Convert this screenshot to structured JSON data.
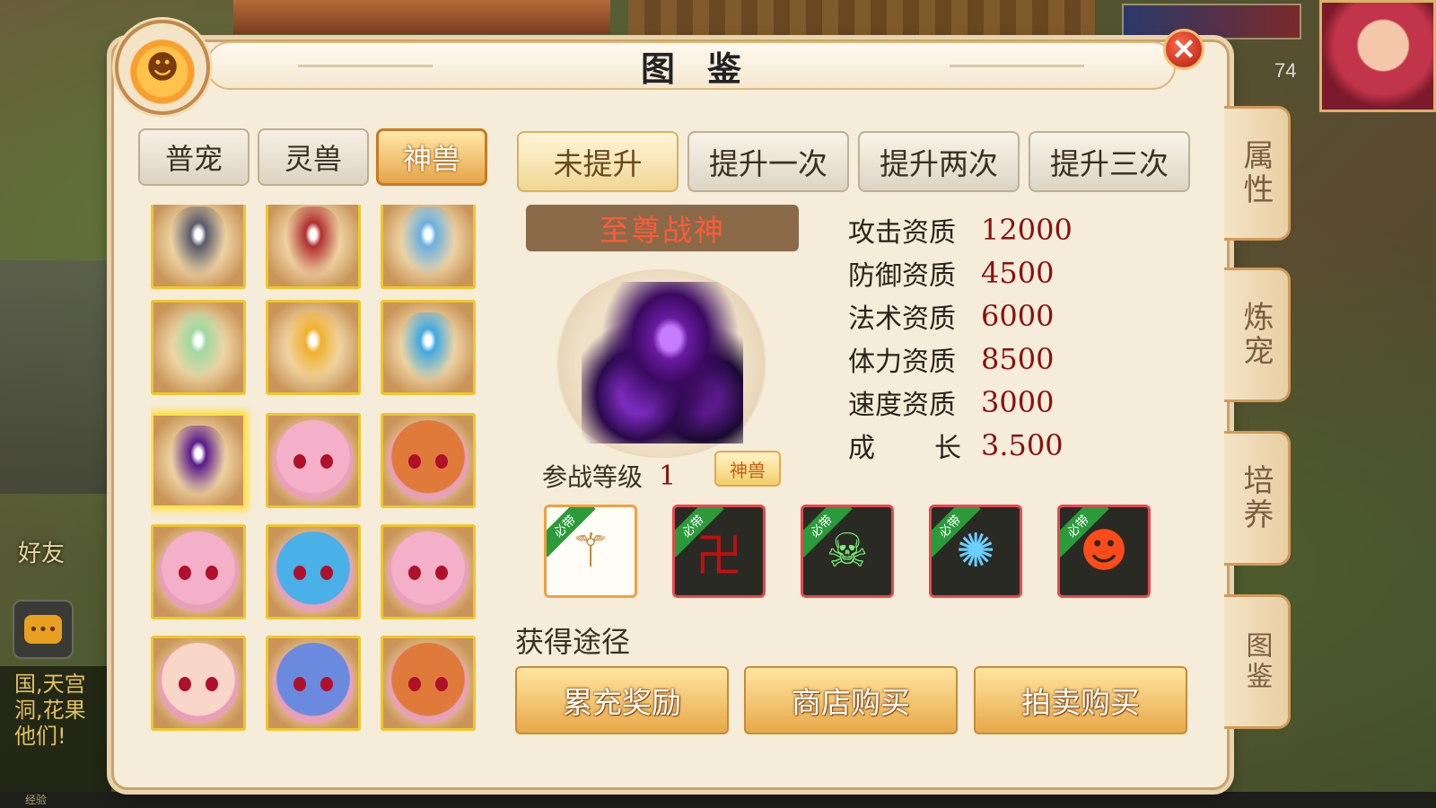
{
  "window": {
    "title": "图鉴"
  },
  "background": {
    "level_badge": "74",
    "friends_label": "好友",
    "chat_log": [
      "国,天宫",
      "洞,花果",
      "他们!"
    ],
    "exp_label": "经验"
  },
  "category_tabs": [
    {
      "label": "普宠",
      "active": false
    },
    {
      "label": "灵兽",
      "active": false
    },
    {
      "label": "神兽",
      "active": true
    }
  ],
  "upgrade_tabs": [
    {
      "label": "未提升",
      "active": true
    },
    {
      "label": "提升一次",
      "active": false
    },
    {
      "label": "提升两次",
      "active": false
    },
    {
      "label": "提升三次",
      "active": false
    }
  ],
  "pets": [
    {
      "name": "pet-1",
      "color": "#5a5a6a"
    },
    {
      "name": "pet-2",
      "color": "#b03030"
    },
    {
      "name": "pet-3",
      "color": "#6ab0e0"
    },
    {
      "name": "pet-4",
      "color": "#a0d8a0"
    },
    {
      "name": "pet-5",
      "color": "#f0b030"
    },
    {
      "name": "pet-6",
      "color": "#40a8e0"
    },
    {
      "name": "pet-7",
      "color": "#5a1a8a",
      "selected": true
    },
    {
      "name": "pet-8",
      "color": "#f4b0c8"
    },
    {
      "name": "pet-9",
      "color": "#e07a3a"
    },
    {
      "name": "pet-10",
      "color": "#f4b0c8"
    },
    {
      "name": "pet-11",
      "color": "#4ab0e8"
    },
    {
      "name": "pet-12",
      "color": "#f4b0c8"
    },
    {
      "name": "pet-13",
      "color": "#f8d6c8"
    },
    {
      "name": "pet-14",
      "color": "#6a8ae0"
    },
    {
      "name": "pet-15",
      "color": "#e07a3a"
    }
  ],
  "selected_pet": {
    "name": "至尊战神",
    "battle_level_label": "参战等级",
    "battle_level": "1",
    "badge": "神兽",
    "stats": [
      {
        "label": "攻击资质",
        "value": "12000"
      },
      {
        "label": "防御资质",
        "value": "4500"
      },
      {
        "label": "法术资质",
        "value": "6000"
      },
      {
        "label": "体力资质",
        "value": "8500"
      },
      {
        "label": "速度资质",
        "value": "3000"
      },
      {
        "label": "成长",
        "label_chars": [
          "成",
          "长"
        ],
        "value": "3.500"
      }
    ]
  },
  "skills": [
    {
      "ribbon": "必带",
      "icon": "staff-icon",
      "glyph": "⚚",
      "color": "#c07a20"
    },
    {
      "ribbon": "必带",
      "icon": "rune-icon",
      "glyph": "卍",
      "color": "#c01010"
    },
    {
      "ribbon": "必带",
      "icon": "skulls-icon",
      "glyph": "☠",
      "color": "#7af07a"
    },
    {
      "ribbon": "必带",
      "icon": "orb-icon",
      "glyph": "✺",
      "color": "#6ad0ff"
    },
    {
      "ribbon": "必带",
      "icon": "flame-face-icon",
      "glyph": "☻",
      "color": "#ff4a1a"
    }
  ],
  "acquisition": {
    "title": "获得途径",
    "buttons": [
      "累充奖励",
      "商店购买",
      "拍卖购买"
    ]
  },
  "side_tabs": [
    "属性",
    "炼宠",
    "培养",
    "图鉴"
  ]
}
